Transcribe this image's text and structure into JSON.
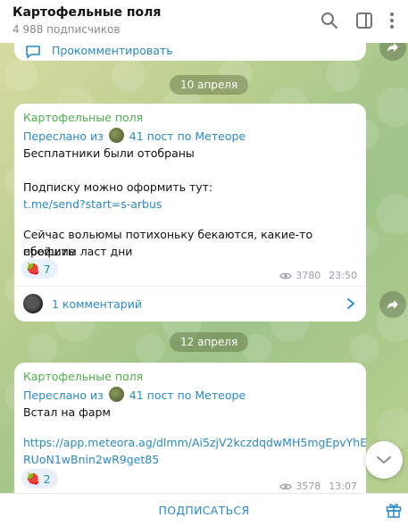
{
  "header": {
    "title": "Картофельные поля",
    "subtitle": "4 988 подписчиков"
  },
  "prev_message": {
    "comment_label": "Прокомментировать"
  },
  "messages": [
    {
      "date": "10 апреля",
      "channel": "Картофельные поля",
      "forwarded_prefix": "Переслано из",
      "forwarded_from": "41 пост по Метеоре",
      "lines": [
        "Бесплатники были отобраны",
        "Подписку можно оформить тут:",
        "t.me/send?start=s-arbus",
        "Сейчас вольюмы потихоньку бекаются, какие-то ебейшие",
        "профиты ласт дни"
      ],
      "reaction_emoji": "🍓",
      "reaction_count": "7",
      "views": "3780",
      "time": "23:50",
      "comments_label": "1 комментарий"
    },
    {
      "date": "12 апреля",
      "channel": "Картофельные поля",
      "forwarded_prefix": "Переслано из",
      "forwarded_from": "41 пост по Метеоре",
      "lines": [
        "Встал на фарм",
        "https://app.meteora.ag/dlmm/Ai5zjV2kczdqdwMH5mgEpvYhE",
        "RUoN1wBnin2wR9get85"
      ],
      "reaction_emoji": "🍓",
      "reaction_count": "2",
      "views": "3578",
      "time": "13:07"
    }
  ],
  "footer": {
    "subscribe_label": "ПОДПИСАТЬСЯ"
  },
  "colors": {
    "accent": "#2a8ac7",
    "channel_name": "#4fae4e"
  }
}
